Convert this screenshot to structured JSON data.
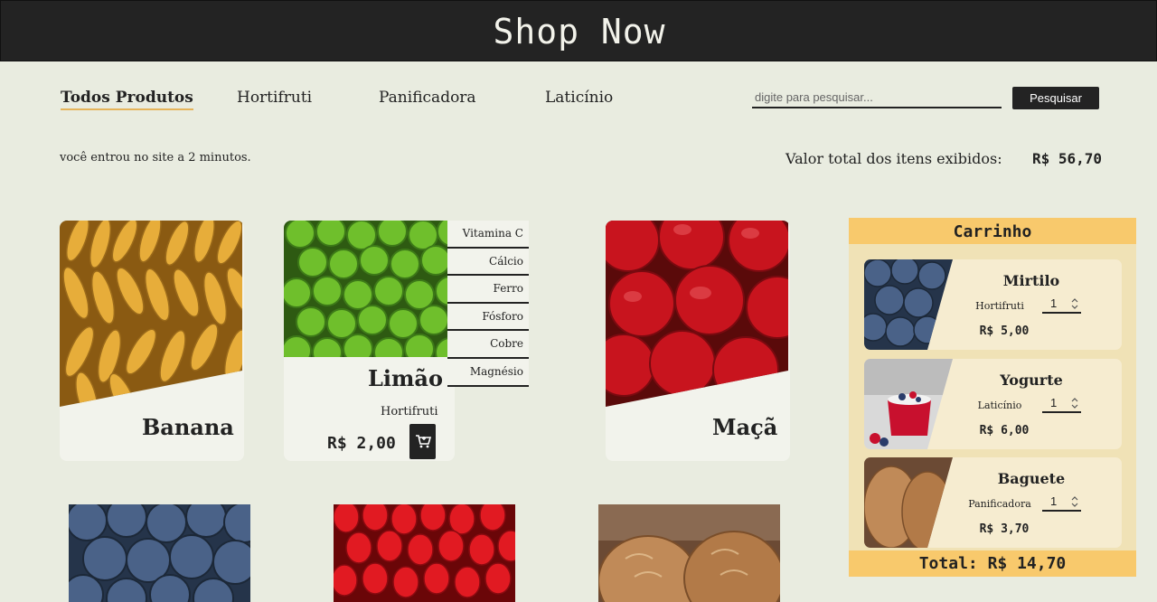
{
  "header": {
    "title": "Shop Now"
  },
  "nav": {
    "items": [
      {
        "label": "Todos Produtos",
        "active": true
      },
      {
        "label": "Hortifruti",
        "active": false
      },
      {
        "label": "Panificadora",
        "active": false
      },
      {
        "label": "Laticínio",
        "active": false
      }
    ]
  },
  "search": {
    "placeholder": "digite para pesquisar...",
    "button_label": "Pesquisar"
  },
  "session": {
    "text": "você entrou no site a  2 minutos."
  },
  "summary": {
    "label": "Valor total dos itens exibidos:",
    "value": "R$ 56,70"
  },
  "products": [
    {
      "name": "Banana",
      "image": "bananas"
    },
    {
      "name": "Limão",
      "category": "Hortifruti",
      "price": "R$ 2,00",
      "image": "limes",
      "cart_icon": "add-to-cart-icon",
      "nutrients": [
        "Vitamina C",
        "Cálcio",
        "Ferro",
        "Fósforo",
        "Cobre",
        "Magnésio"
      ]
    },
    {
      "name": "Maçã",
      "image": "apples"
    },
    {
      "image": "blueberries"
    },
    {
      "image": "strawberries"
    },
    {
      "image": "bread"
    }
  ],
  "cart": {
    "title": "Carrinho",
    "items": [
      {
        "name": "Mirtilo",
        "category": "Hortifruti",
        "quantity": "1",
        "price": "R$ 5,00"
      },
      {
        "name": "Yogurte",
        "category": "Laticínio",
        "quantity": "1",
        "price": "R$ 6,00"
      },
      {
        "name": "Baguete",
        "category": "Panificadora",
        "quantity": "1",
        "price": "R$ 3,70"
      }
    ],
    "total": "Total: R$ 14,70"
  },
  "colors": {
    "header_bg": "#232323",
    "page_bg": "#e9ece0",
    "accent": "#f8c96c",
    "active_underline": "#e5b45a"
  }
}
